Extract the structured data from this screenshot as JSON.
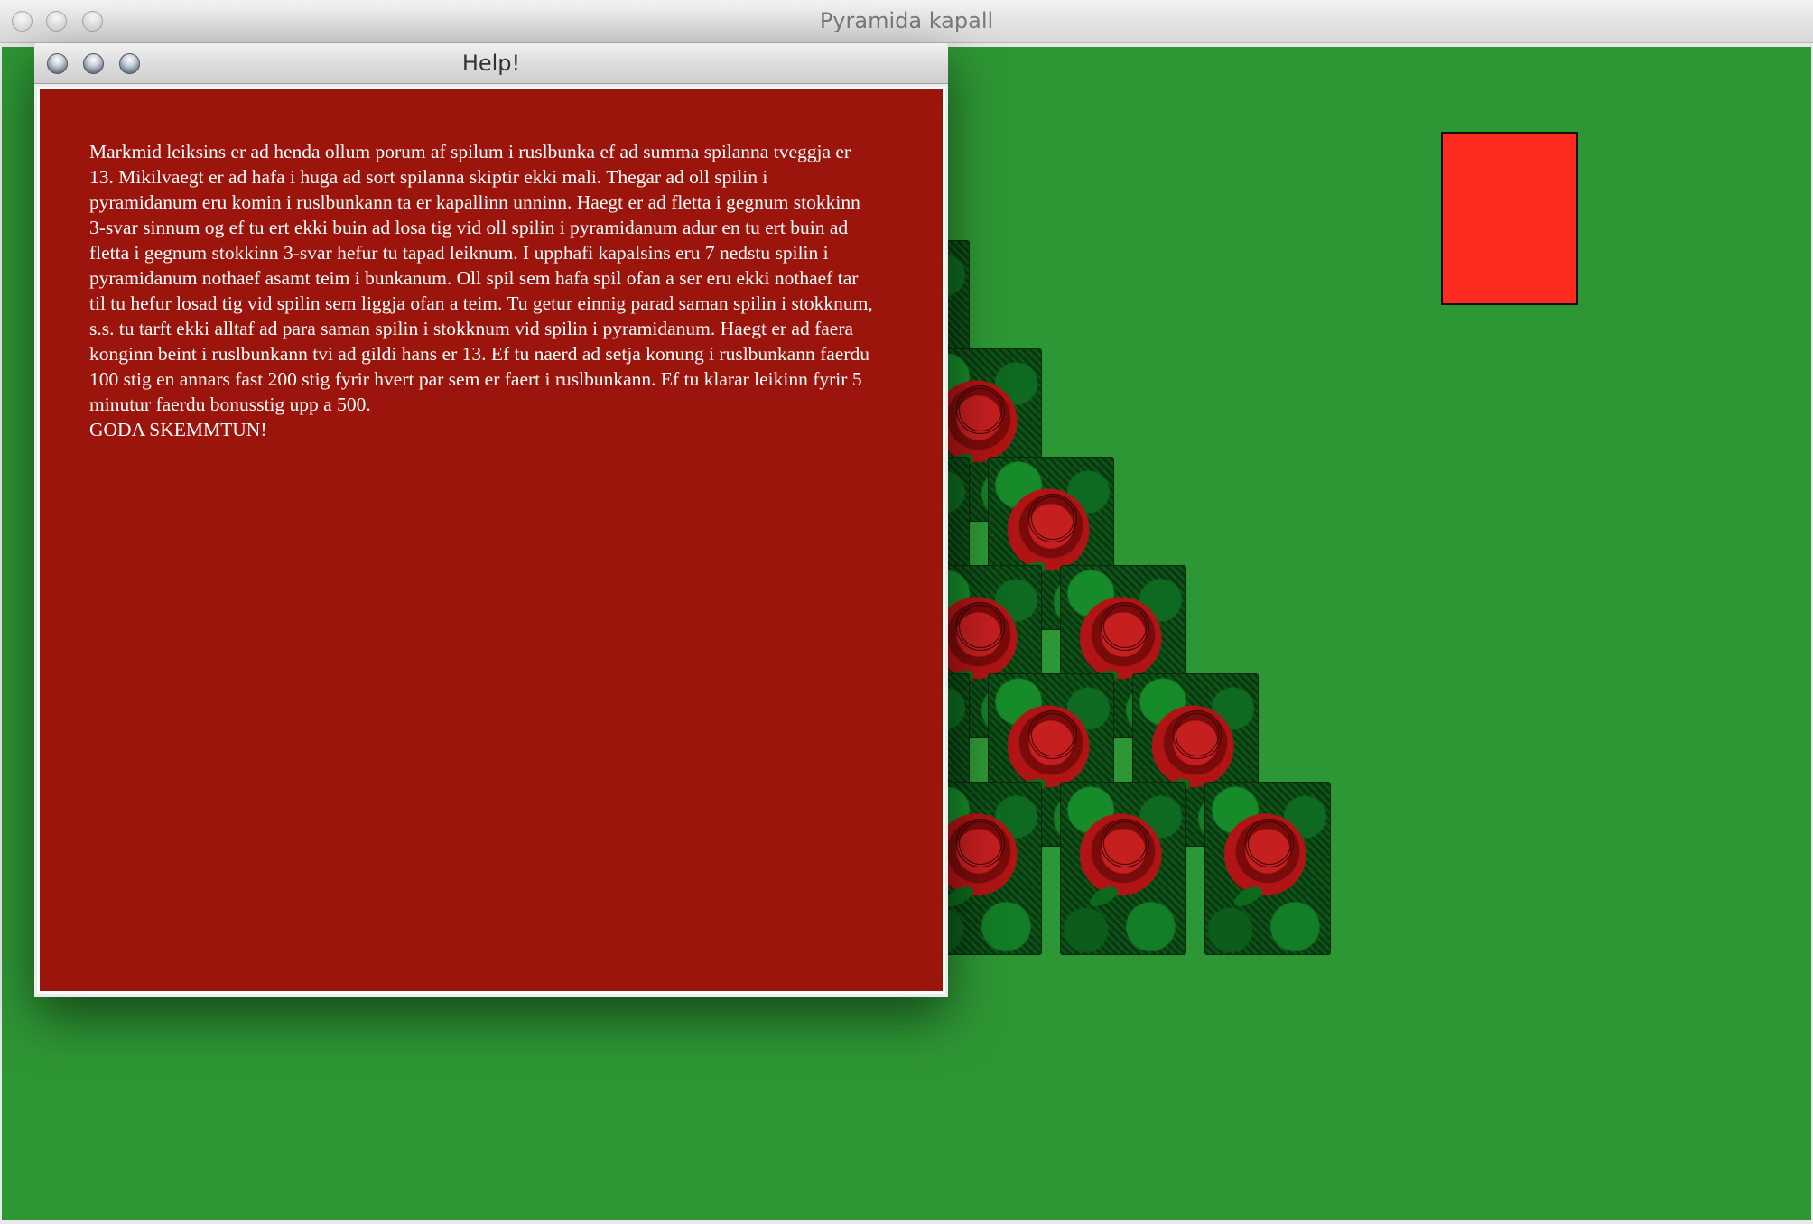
{
  "window": {
    "title": "Pyramida kapall",
    "controls": [
      "close",
      "minimize",
      "zoom"
    ]
  },
  "game": {
    "table_color": "#2e9735",
    "discard_pile_color": "#ff2b1e",
    "card_back": "rose-pattern",
    "pyramid_rows": [
      1,
      2,
      3,
      4,
      5,
      6,
      7
    ]
  },
  "help_dialog": {
    "title": "Help!",
    "panel_color": "#9c150c",
    "text": "Markmid leiksins er ad henda ollum porum af spilum i ruslbunka ef ad summa spilanna tveggja er 13. Mikilvaegt er ad hafa i huga ad sort spilanna skiptir ekki mali. Thegar ad oll spilin i pyramidanum eru komin i ruslbunkann ta er kapallinn unninn. Haegt er ad fletta i gegnum stokkinn 3-svar sinnum og ef tu ert ekki buin ad losa tig vid oll spilin i pyramidanum adur en tu ert buin ad fletta i gegnum stokkinn 3-svar hefur tu tapad leiknum. I upphafi kapalsins eru 7 nedstu spilin i pyramidanum nothaef asamt teim i bunkanum. Oll spil sem hafa spil ofan a ser eru ekki nothaef tar til tu hefur losad tig vid spilin sem liggja ofan a teim. Tu getur einnig parad saman spilin i stokknum, s.s. tu tarft ekki alltaf ad para saman spilin i stokknum vid spilin i pyramidanum. Haegt er ad faera konginn beint i ruslbunkann tvi ad gildi hans er 13. Ef tu naerd ad setja konung i ruslbunkann faerdu 100 stig en annars fast 200 stig fyrir hvert par sem er faert i ruslbunkann. Ef tu klarar leikinn fyrir 5 minutur faerdu bonusstig upp a 500.",
    "closing": "GODA SKEMMTUN!"
  }
}
